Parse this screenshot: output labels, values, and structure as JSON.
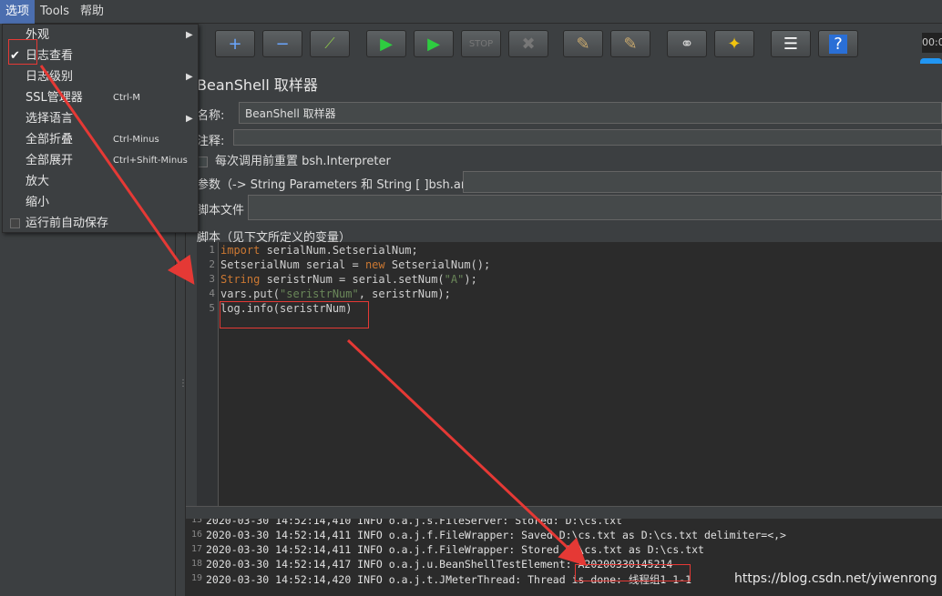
{
  "menubar": {
    "items": [
      "选项",
      "Tools",
      "帮助"
    ]
  },
  "options_menu": {
    "items": [
      {
        "label": "外观",
        "submenu": true
      },
      {
        "label": "日志查看",
        "checked": true
      },
      {
        "label": "日志级别",
        "submenu": true
      },
      {
        "label": "SSL管理器",
        "shortcut": "Ctrl-M"
      },
      {
        "label": "选择语言",
        "submenu": true
      },
      {
        "label": "全部折叠",
        "shortcut": "Ctrl-Minus"
      },
      {
        "label": "全部展开",
        "shortcut": "Ctrl+Shift-Minus"
      },
      {
        "label": "放大"
      },
      {
        "label": "缩小"
      },
      {
        "label": "运行前自动保存",
        "checkbox": true
      }
    ]
  },
  "toolbar": {
    "timer": "00:0",
    "icons": [
      "add-icon",
      "remove-icon",
      "toggle-icon",
      "start-icon",
      "start-no-pause-icon",
      "stop-icon",
      "shutdown-icon",
      "clear-icon",
      "clear-all-icon",
      "search-icon",
      "reset-search-icon",
      "function-helper-icon",
      "help-icon"
    ]
  },
  "sampler": {
    "title": "BeanShell 取样器",
    "name_label": "名称:",
    "name_value": "BeanShell 取样器",
    "comment_label": "注释:",
    "reset_label": "每次调用前重置 bsh.Interpreter",
    "params_label": "参数（-> String Parameters 和 String [ ]bsh.args）",
    "script_file_label": "脚本文件",
    "script_label": "脚本（见下文所定义的变量）"
  },
  "script": {
    "lines": [
      {
        "n": "1",
        "parts": [
          [
            "kw",
            "import"
          ],
          [
            "t",
            " serialNum.SetserialNum;"
          ]
        ]
      },
      {
        "n": "2",
        "parts": [
          [
            "t",
            "SetserialNum serial = "
          ],
          [
            "kw",
            "new"
          ],
          [
            "t",
            " SetserialNum();"
          ]
        ]
      },
      {
        "n": "3",
        "parts": [
          [
            "kw",
            "String"
          ],
          [
            "t",
            " seristrNum = serial.setNum("
          ],
          [
            "str",
            "\"A\""
          ],
          [
            "t",
            ");"
          ]
        ]
      },
      {
        "n": "4",
        "parts": [
          [
            "t",
            "vars.put("
          ],
          [
            "str",
            "\"seristrNum\""
          ],
          [
            "t",
            ", seristrNum);"
          ]
        ]
      },
      {
        "n": "5",
        "parts": [
          [
            "t",
            "log.info(seristrNum)"
          ]
        ]
      }
    ]
  },
  "log": {
    "lines": [
      {
        "n": "15",
        "text": "2020-03-30 14:52:14,410 INFO o.a.j.s.FileServer: Stored: D:\\cs.txt"
      },
      {
        "n": "16",
        "text": "2020-03-30 14:52:14,411 INFO o.a.j.f.FileWrapper: Saved D:\\cs.txt as D:\\cs.txt delimiter=<,>"
      },
      {
        "n": "17",
        "text": "2020-03-30 14:52:14,411 INFO o.a.j.f.FileWrapper: Stored D:\\cs.txt as D:\\cs.txt"
      },
      {
        "n": "18",
        "text": "2020-03-30 14:52:14,417 INFO o.a.j.u.BeanShellTestElement: A20200330145214"
      },
      {
        "n": "19",
        "text": "2020-03-30 14:52:14,420 INFO o.a.j.t.JMeterThread: Thread is done: 线程组1 1-1"
      }
    ]
  },
  "watermark": "https://blog.csdn.net/yiwenrong",
  "colors": {
    "annotation": "#e53935",
    "keyword": "#cc7832",
    "string": "#6a8759"
  }
}
